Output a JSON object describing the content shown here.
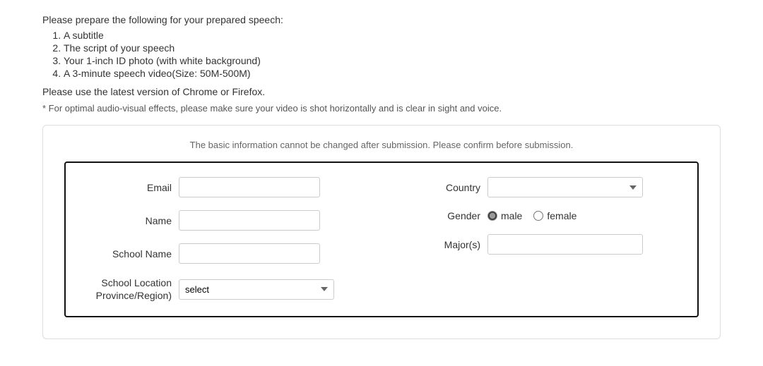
{
  "instructions": {
    "prepare_text": "Please prepare the following for your prepared speech:",
    "items": [
      "A subtitle",
      "The script of your speech",
      "Your 1-inch ID photo (with white background)",
      "A 3-minute speech video(Size: 50M-500M)"
    ],
    "chrome_note": "Please use the latest version of Chrome or Firefox.",
    "av_note": "* For optimal audio-visual effects, please make sure your video is shot horizontally and is clear in sight and voice."
  },
  "form": {
    "notice": "The basic information cannot be changed after submission. Please confirm before submission.",
    "fields": {
      "email_label": "Email",
      "name_label": "Name",
      "school_name_label": "School Name",
      "school_location_label": "School Location\nProvince/Region)",
      "country_label": "Country",
      "gender_label": "Gender",
      "majors_label": "Major(s)"
    },
    "gender_options": {
      "male": "male",
      "female": "female"
    },
    "school_location_select_default": "select",
    "country_select_placeholder": "",
    "country_options": [],
    "school_location_options": []
  },
  "icons": {
    "dropdown_arrow": "▾"
  }
}
